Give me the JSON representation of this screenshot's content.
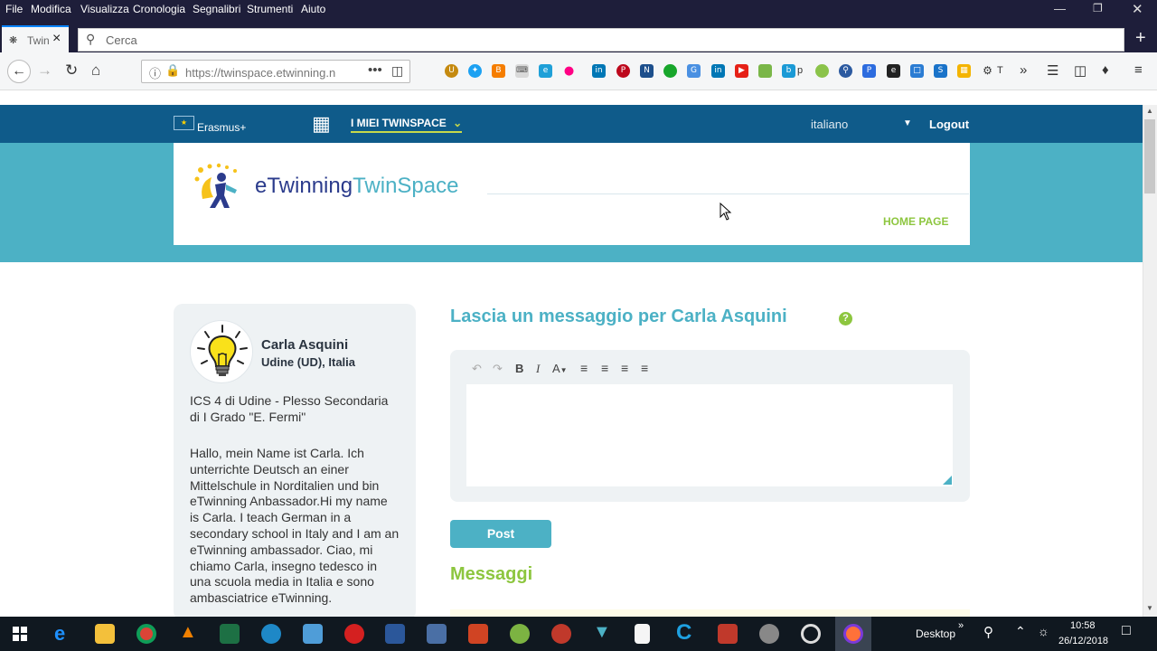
{
  "menubar": {
    "items": [
      "File",
      "Modifica",
      "Visualizza",
      "Cronologia",
      "Segnalibri",
      "Strumenti",
      "Aiuto"
    ]
  },
  "tab": {
    "title": "Twin",
    "favicon": "twinspace-favicon-icon"
  },
  "search": {
    "placeholder": "Cerca"
  },
  "urlbar": {
    "url": "https://twinspace.etwinning.n",
    "page_actions": "•••"
  },
  "toolbar_right": {
    "overflow": "»",
    "library": "library-icon",
    "sidebar": "sidebar-icon",
    "menu": "menu-icon"
  },
  "extensions_trailing_labels": [
    "p",
    "T"
  ],
  "site": {
    "erasmus_label": "Erasmus+",
    "miei_twinspace": "I MIEI TWINSPACE",
    "language": "italiano",
    "logout": "Logout",
    "logo_etwinning": "eTwinning",
    "logo_twinspace": "TwinSpace",
    "home_page": "HOME PAGE"
  },
  "profile": {
    "name": "Carla Asquini",
    "location": "Udine (UD), Italia",
    "school": "ICS 4 di Udine - Plesso Secondaria di I Grado \"E. Fermi\"",
    "bio": "Hallo, mein Name ist Carla. Ich unterrichte Deutsch an einer Mittelschule in Norditalien und bin eTwinning Anbassador.Hi my name is Carla. I teach German in a secondary school in Italy and I am an eTwinning ambassador. Ciao, mi chiamo Carla, insegno tedesco in una scuola media in Italia e sono ambasciatrice eTwinning."
  },
  "message": {
    "heading": "Lascia un messaggio per Carla Asquini",
    "help": "?",
    "post_label": "Post",
    "messages_heading": "Messaggi"
  },
  "editor_toolbar": [
    "undo-icon",
    "redo-icon",
    "bold-icon",
    "italic-icon",
    "font-color-icon",
    "align-left-icon",
    "align-center-icon",
    "align-right-icon",
    "align-justify-icon"
  ],
  "taskbar": {
    "desktop_label": "Desktop",
    "time": "10:58",
    "date": "26/12/2018"
  },
  "colors": {
    "menubar": "#1e1e3a",
    "site_topbar": "#0f5b8a",
    "teal": "#4cb1c5",
    "green": "#8dc63f",
    "card": "#eef2f4"
  }
}
